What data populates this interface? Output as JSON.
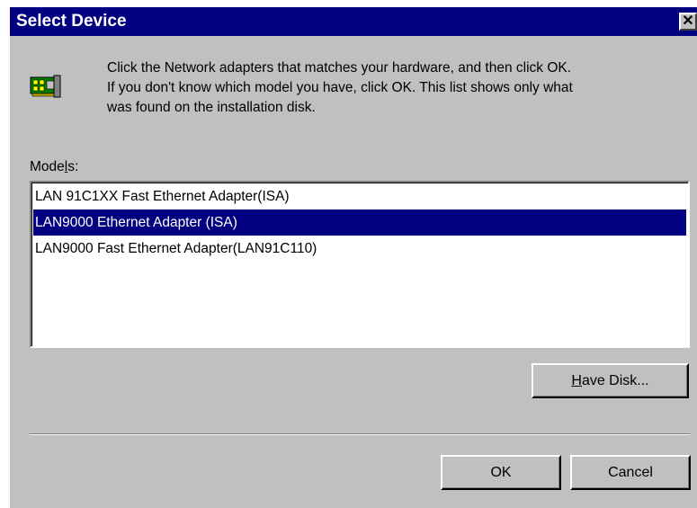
{
  "window": {
    "title": "Select Device",
    "close_glyph": "✕"
  },
  "icon": "network-adapter-icon",
  "instructions": {
    "line1": "Click the Network adapters that matches your hardware, and then click OK.",
    "line2": "If you don't know which model you have, click OK. This list shows only what",
    "line3": "was found on the installation disk."
  },
  "models": {
    "label_pre": "Mode",
    "label_accel": "l",
    "label_post": "s:",
    "items": [
      "LAN 91C1XX Fast Ethernet Adapter(ISA)",
      "LAN9000 Ethernet Adapter (ISA)",
      "LAN9000 Fast Ethernet Adapter(LAN91C110)"
    ],
    "selected_index": 1
  },
  "buttons": {
    "have_disk_accel": "H",
    "have_disk_rest": "ave Disk...",
    "ok": "OK",
    "cancel": "Cancel"
  },
  "colors": {
    "titlebar": "#000080",
    "dialog": "#c0c0c0",
    "selection": "#000080"
  }
}
